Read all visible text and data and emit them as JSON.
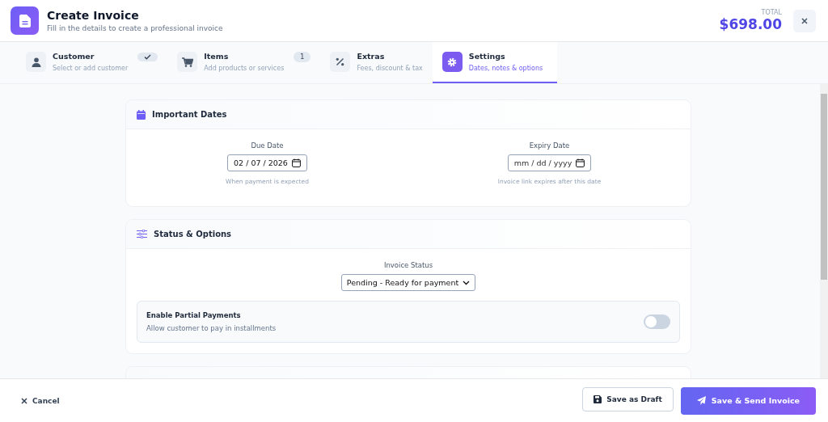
{
  "header": {
    "title": "Create Invoice",
    "subtitle": "Fill in the details to create a professional invoice",
    "total_label": "TOTAL",
    "total": "$698.00"
  },
  "steps": [
    {
      "kind": "person",
      "title": "Customer",
      "subtitle": "Select or add customer",
      "done": true,
      "selected": false
    },
    {
      "kind": "cart",
      "title": "Items",
      "subtitle": "Add products or services",
      "badge": "1",
      "done": false,
      "selected": false
    },
    {
      "kind": "percent",
      "title": "Extras",
      "subtitle": "Fees, discount & tax",
      "done": false,
      "selected": false
    },
    {
      "kind": "gear",
      "title": "Settings",
      "subtitle": "Dates, notes & options",
      "done": false,
      "selected": true
    }
  ],
  "dates_card": {
    "title": "Important Dates",
    "fields": [
      {
        "label": "Due Date",
        "value": "02 / 07 / 2026",
        "hint": "When payment is expected"
      },
      {
        "label": "Expiry Date",
        "placeholder": "mm / dd / yyyy",
        "hint": "Invoice link expires after this date"
      }
    ]
  },
  "status_card": {
    "title": "Status & Options",
    "status_label": "Invoice Status",
    "status_value": "Pending - Ready for payment",
    "partial": {
      "title": "Enable Partial Payments",
      "description": "Allow customer to pay in installments",
      "on": false
    }
  },
  "footer": {
    "cancel": "Cancel",
    "draft": "Save as Draft",
    "send": "Save & Send Invoice"
  }
}
